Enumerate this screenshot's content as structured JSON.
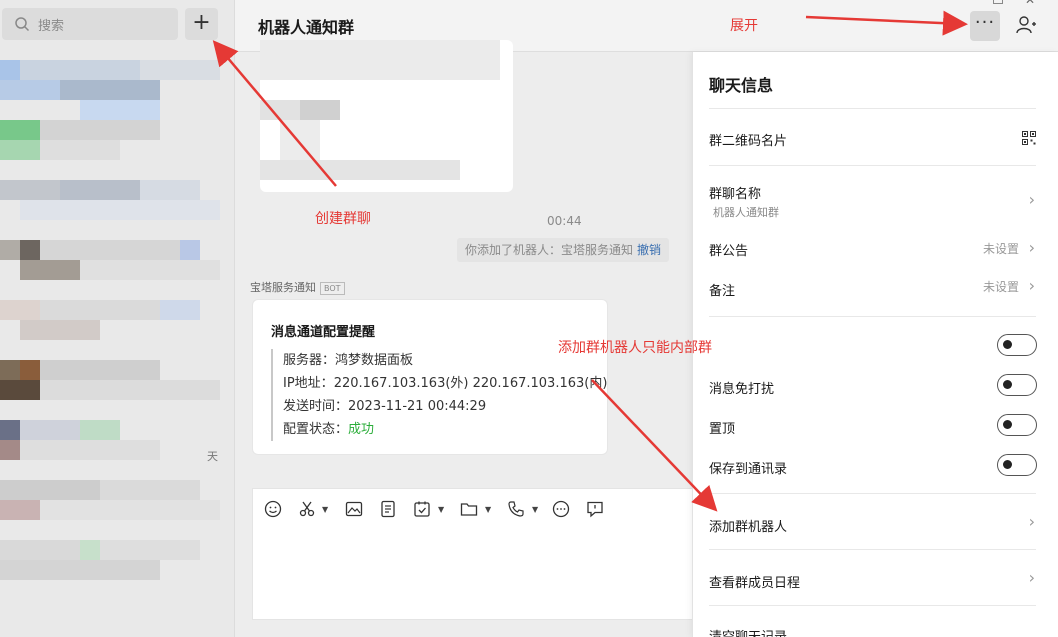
{
  "sidebar": {
    "search_placeholder": "搜索",
    "add_label": "+",
    "peek_text": "天"
  },
  "chat": {
    "title": "机器人通知群",
    "time": "00:44",
    "system_note": "你添加了机器人：宝塔服务通知",
    "undo_label": "撤销",
    "sender": "宝塔服务通知",
    "bot_tag": "BOT",
    "card": {
      "title": "消息通道配置提醒",
      "lines": [
        {
          "label": "服务器：",
          "value": "鸿梦数据面板"
        },
        {
          "label": "IP地址：",
          "value": "220.167.103.163(外) 220.167.103.163(内)"
        },
        {
          "label": "发送时间：",
          "value": "2023-11-21 00:44:29"
        },
        {
          "label": "配置状态：",
          "value": "成功"
        }
      ]
    },
    "more_label": "···"
  },
  "panel": {
    "title": "聊天信息",
    "qr_label": "群二维码名片",
    "name_label": "群聊名称",
    "name_value": "机器人通知群",
    "notice_label": "群公告",
    "notice_value": "未设置",
    "remark_label": "备注",
    "remark_value": "未设置",
    "toggles": [
      {
        "label": "",
        "on": false
      },
      {
        "label": "消息免打扰",
        "on": false
      },
      {
        "label": "置顶",
        "on": false
      },
      {
        "label": "保存到通讯录",
        "on": false
      }
    ],
    "add_bot_label": "添加群机器人",
    "schedule_label": "查看群成员日程",
    "clear_label": "清空聊天记录"
  },
  "annotations": {
    "expand": "展开",
    "create_group": "创建群聊",
    "add_bot_note": "添加群机器人只能内部群"
  },
  "colors": {
    "annotation": "#e53935",
    "success": "#2bad3a",
    "link": "#3a6fb0"
  }
}
